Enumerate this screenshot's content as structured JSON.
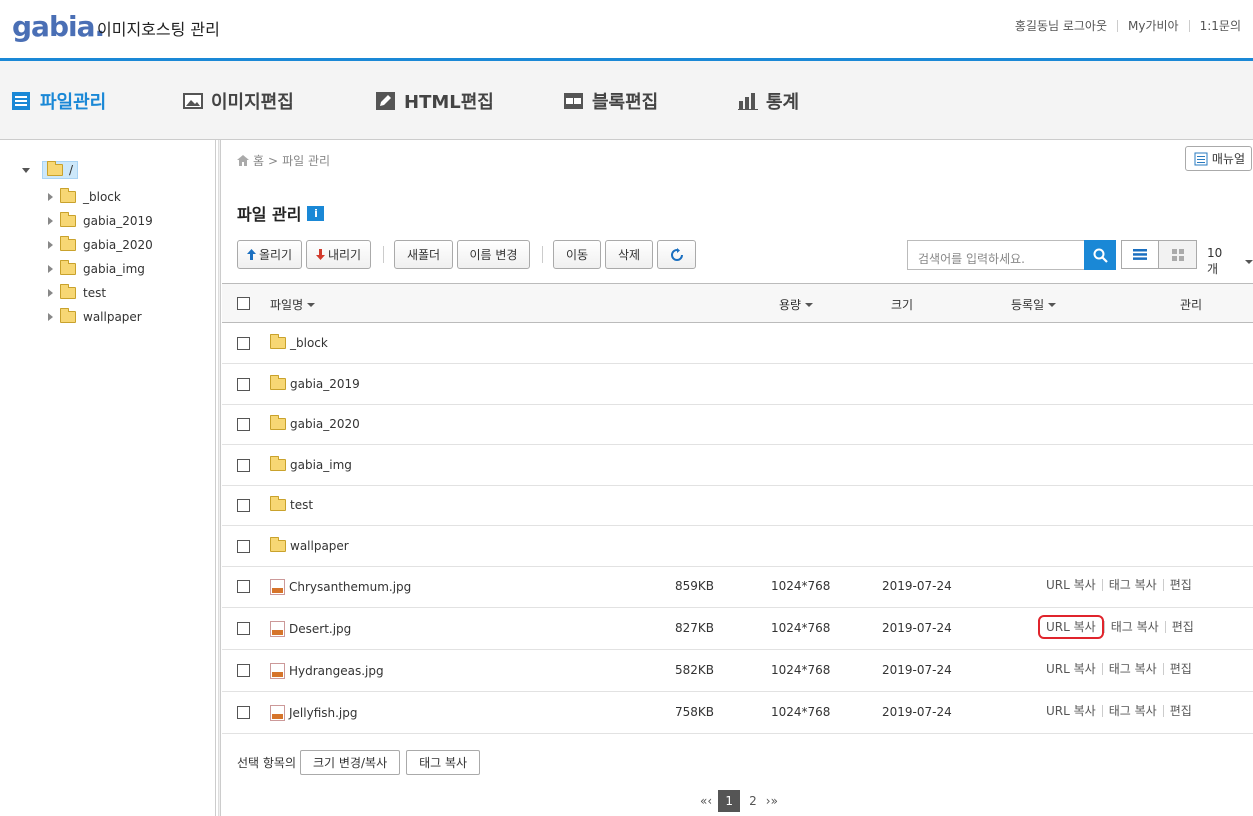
{
  "header": {
    "logo": "gabia.",
    "app_title": "이미지호스팅 관리",
    "user_links": [
      "홍길동님 로그아웃",
      "My가비아",
      "1:1문의"
    ]
  },
  "tabs": [
    {
      "label": "파일관리",
      "icon": "list-icon",
      "active": true
    },
    {
      "label": "이미지편집",
      "icon": "image-icon",
      "active": false
    },
    {
      "label": "HTML편집",
      "icon": "pencil-icon",
      "active": false
    },
    {
      "label": "블록편집",
      "icon": "block-icon",
      "active": false
    },
    {
      "label": "통계",
      "icon": "bar-chart-icon",
      "active": false
    }
  ],
  "tree": {
    "root": "/",
    "children": [
      "_block",
      "gabia_2019",
      "gabia_2020",
      "gabia_img",
      "test",
      "wallpaper"
    ]
  },
  "breadcrumb": {
    "home": "홈",
    "sep": ">",
    "current": "파일 관리"
  },
  "manual_label": "매뉴얼",
  "page_title": "파일 관리",
  "toolbar": {
    "upload": "올리기",
    "download": "내리기",
    "new_folder": "새폴더",
    "rename": "이름 변경",
    "move": "이동",
    "delete": "삭제",
    "search_placeholder": "검색어를 입력하세요.",
    "per_page": "10개"
  },
  "columns": {
    "name": "파일명",
    "capacity": "용량",
    "size": "크기",
    "date": "등록일",
    "manage": "관리"
  },
  "folders": [
    "_block",
    "gabia_2019",
    "gabia_2020",
    "gabia_img",
    "test",
    "wallpaper"
  ],
  "files": [
    {
      "name": "Chrysanthemum.jpg",
      "capacity": "859KB",
      "size": "1024*768",
      "date": "2019-07-24"
    },
    {
      "name": "Desert.jpg",
      "capacity": "827KB",
      "size": "1024*768",
      "date": "2019-07-24",
      "highlight": true
    },
    {
      "name": "Hydrangeas.jpg",
      "capacity": "582KB",
      "size": "1024*768",
      "date": "2019-07-24"
    },
    {
      "name": "Jellyfish.jpg",
      "capacity": "758KB",
      "size": "1024*768",
      "date": "2019-07-24"
    }
  ],
  "row_actions": {
    "url_copy": "URL 복사",
    "tag_copy": "태그 복사",
    "edit": "편집"
  },
  "footer": {
    "selected_label": "선택 항목의",
    "resize_copy": "크기 변경/복사",
    "tag_copy": "태그 복사"
  },
  "pagination": {
    "prev": "«‹",
    "pages": [
      "1",
      "2"
    ],
    "current": "1",
    "next": "›»"
  },
  "colors": {
    "accent": "#1a88d6",
    "highlight": "#e0242c"
  }
}
